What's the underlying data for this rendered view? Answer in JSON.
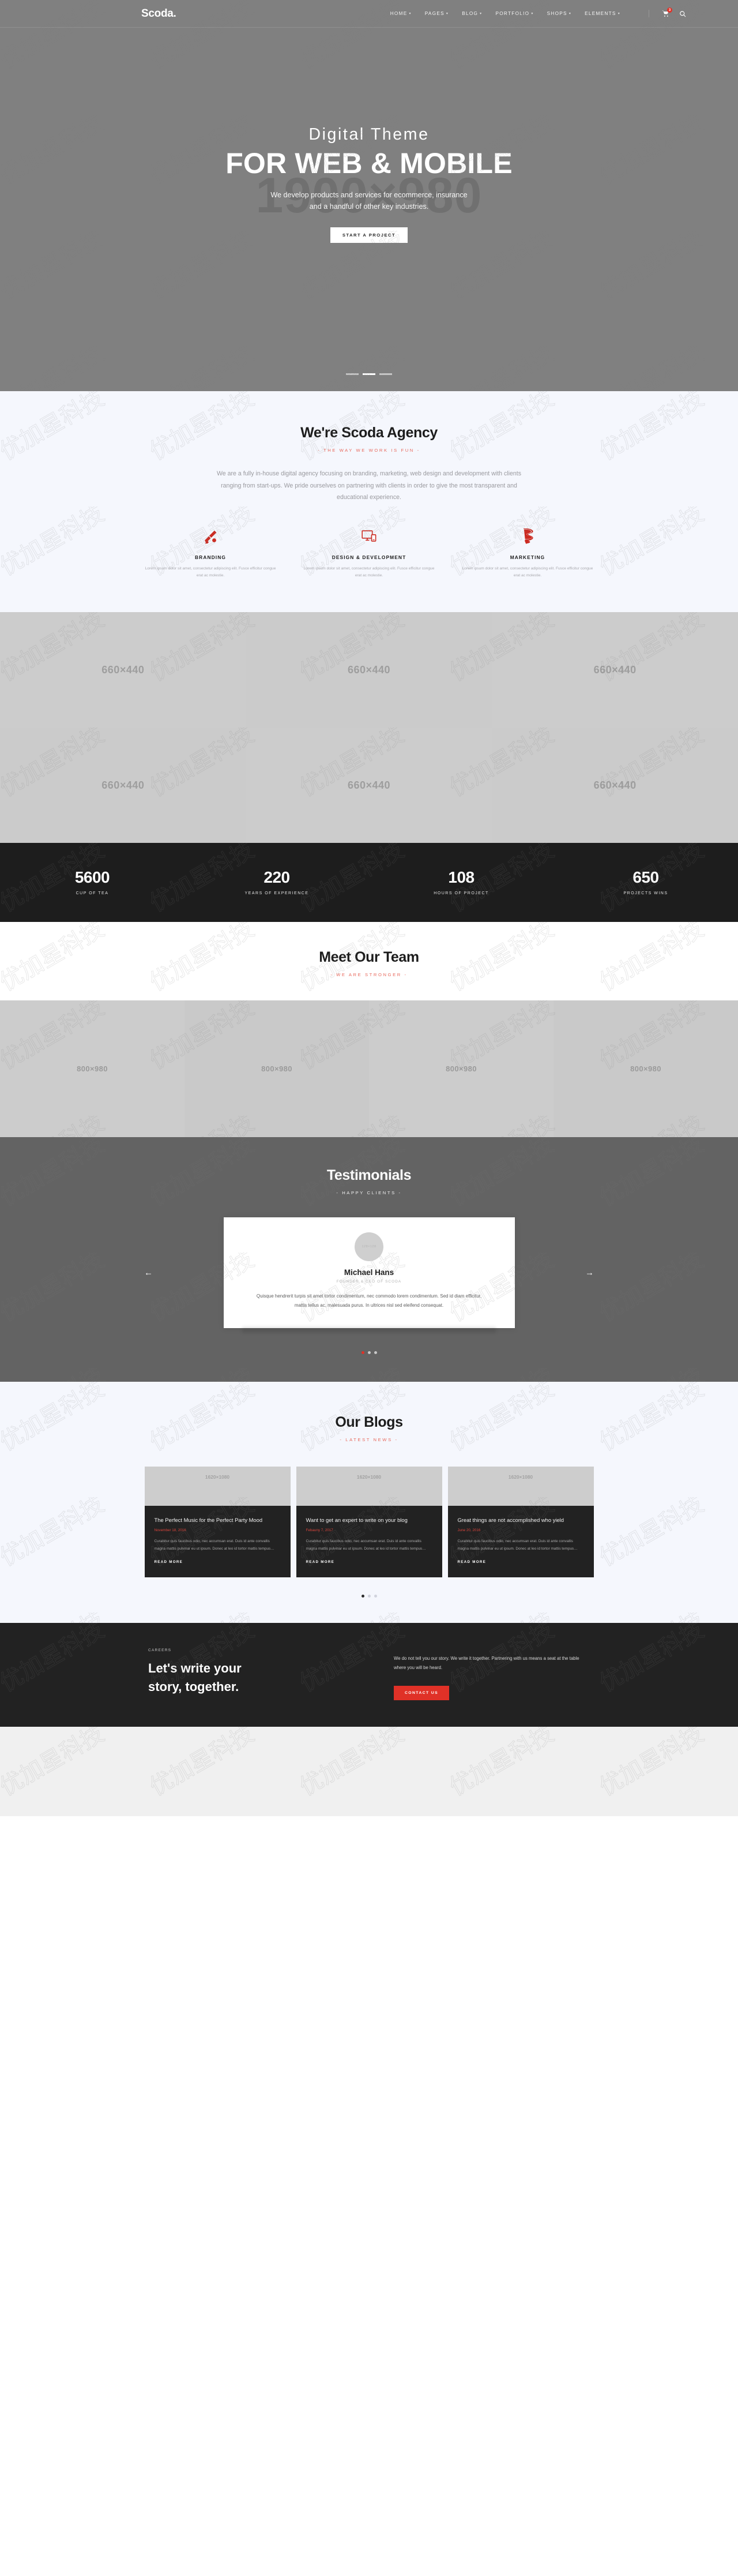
{
  "header": {
    "brand": "Scoda.",
    "nav": [
      {
        "label": "HOME",
        "caret": true
      },
      {
        "label": "PAGES",
        "caret": true
      },
      {
        "label": "BLOG",
        "caret": true
      },
      {
        "label": "PORTFOLIO",
        "caret": true
      },
      {
        "label": "SHOPS",
        "caret": true
      },
      {
        "label": "ELEMENTS",
        "caret": true
      }
    ],
    "cart_badge": "3",
    "cart_icon": "shopping-cart-icon",
    "search_icon": "search-icon"
  },
  "hero": {
    "placeholder": "1900×980",
    "subtitle": "Digital Theme",
    "title": "FOR WEB & MOBILE",
    "description_line1": "We develop products and services for ecommerce, insurance",
    "description_line2": "and a handful of other key industries.",
    "button": "START A PROJECT",
    "slides": 3,
    "active_slide": 1
  },
  "about": {
    "title": "We're Scoda Agency",
    "kicker": "- THE WAY WE WORK IS FUN -",
    "text": "We are a fully in-house digital agency focusing on branding, marketing, web design and development with clients ranging from start-ups. We pride ourselves on partnering with clients in order to give the most transparent and educational experience.",
    "services": [
      {
        "icon": "paint-brush-icon",
        "title": "BRANDING",
        "desc": "Lorem ipsum dolor sit amet, consectetur adipiscing elit. Fusce efficitur congue erat ac molestie."
      },
      {
        "icon": "responsive-devices-icon",
        "title": "DESIGN & DEVELOPMENT",
        "desc": "Lorem ipsum dolor sit amet, consectetur adipiscing elit. Fusce efficitur congue erat ac molestie."
      },
      {
        "icon": "megaphone-ribbon-icon",
        "title": "MARKETING",
        "desc": "Lorem ipsum dolor sit amet, consectetur adipiscing elit. Fusce efficitur congue erat ac molestie."
      }
    ],
    "accent_color": "#e8685c"
  },
  "portfolio": {
    "cells": [
      "660×440",
      "660×440",
      "660×440",
      "660×440",
      "660×440",
      "660×440"
    ]
  },
  "counters": [
    {
      "number": "5600",
      "label": "CUP OF TEA"
    },
    {
      "number": "220",
      "label": "YEARS OF EXPERIENCE"
    },
    {
      "number": "108",
      "label": "HOURS OF PROJECT"
    },
    {
      "number": "650",
      "label": "PROJECTS WINS"
    }
  ],
  "team": {
    "title": "Meet Our Team",
    "kicker": "- WE ARE STRONGER -",
    "cells": [
      "800×980",
      "800×980",
      "800×980",
      "800×980"
    ]
  },
  "testimonials": {
    "title": "Testimonials",
    "kicker": "- HAPPY CLIENTS -",
    "prev_icon": "arrow-left-icon",
    "next_icon": "arrow-right-icon",
    "avatar_placeholder": "128×128",
    "name": "Michael Hans",
    "role": "FOUNDER & CEO OF SCODA",
    "quote": "Quisque hendrerit turpis sit amet tortor condimentum, nec commodo lorem condimentum. Sed id diam efficitur, mattis tellus ac, malesuada purus. In ultrices nisl sed eleifend consequat.",
    "dots": 3,
    "active_dot": 0
  },
  "blogs": {
    "title": "Our Blogs",
    "kicker": "- LATEST NEWS -",
    "posts": [
      {
        "image": "1620×1080",
        "title": "The Perfect Music for the Perfect Party Mood",
        "date": "November 18, 2016",
        "excerpt": "Curabitur quis faucibus odio, nec accumsan erat. Duis id ante convallis magna mattis pulvinar eu ut ipsum. Donec at leo id tortor mattis tempus…",
        "read_more": "READ MORE"
      },
      {
        "image": "1620×1080",
        "title": "Want to get an expert to write on your blog",
        "date": "Febauny 7, 2017",
        "excerpt": "Curabitur quis faucibus odio, nec accumsan erat. Duis id ante convallis magna mattis pulvinar eu ut ipsum. Donec at leo id tortor mattis tempus…",
        "read_more": "READ MORE"
      },
      {
        "image": "1620×1080",
        "title": "Great things are not accomplished who yield",
        "date": "June 20, 2016",
        "excerpt": "Curabitur quis faucibus odio, nec accumsan erat. Duis id ante convallis magna mattis pulvinar eu ut ipsum. Donec at leo id tortor mattis tempus…",
        "read_more": "READ MORE"
      }
    ],
    "dots": 3,
    "active_dot": 0
  },
  "cta": {
    "kicker": "CAREERS",
    "title_line1": "Let's write your",
    "title_line2": "story, together.",
    "text": "We do not tell you our story. We write it together. Partnering with us means a seat at the table where you will be heard.",
    "button": "CONTACT US",
    "button_color": "#e03127"
  },
  "watermark": "优加星科技"
}
